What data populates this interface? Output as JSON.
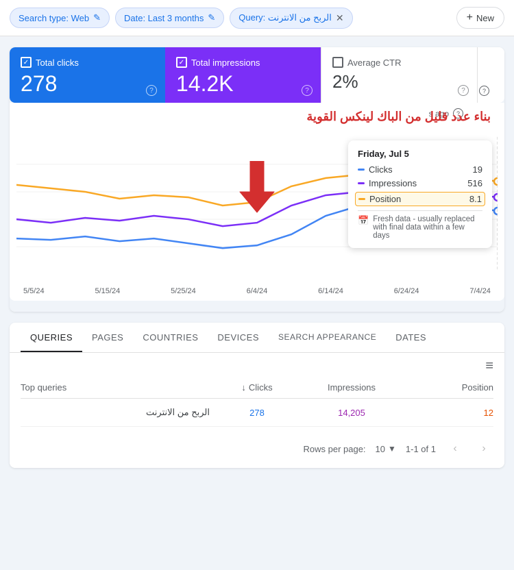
{
  "filterBar": {
    "chips": [
      {
        "id": "search-type",
        "label": "Search type: Web",
        "hasClose": false,
        "hasEdit": true
      },
      {
        "id": "date",
        "label": "Date: Last 3 months",
        "hasClose": false,
        "hasEdit": true
      },
      {
        "id": "query",
        "label": "Query: الربح من الانترنت",
        "hasClose": true,
        "hasEdit": false
      }
    ],
    "newButton": "New",
    "plusIcon": "+"
  },
  "metrics": {
    "totalClicks": {
      "label": "Total clicks",
      "value": "278",
      "checked": true,
      "color": "blue"
    },
    "totalImpressions": {
      "label": "Total impressions",
      "value": "14.2K",
      "checked": true,
      "color": "purple"
    },
    "averageCtr": {
      "label": "Average CTR",
      "value": "2%",
      "checked": false,
      "color": "white"
    }
  },
  "chart": {
    "annotation": "بناء عدد قليل من الباك لينكس القوية",
    "xLabels": [
      "5/5/24",
      "5/15/24",
      "5/25/24",
      "6/4/24",
      "6/14/24",
      "6/24/24",
      "7/4/24"
    ],
    "tooltip": {
      "date": "Friday, Jul 5",
      "agoText": "s ago",
      "rows": [
        {
          "label": "Clicks",
          "value": "19",
          "color": "#4285f4",
          "highlighted": false
        },
        {
          "label": "Impressions",
          "value": "516",
          "color": "#7b2ff7",
          "highlighted": false
        },
        {
          "label": "Position",
          "value": "8.1",
          "color": "#f9a825",
          "highlighted": true
        }
      ],
      "note": "Fresh data - usually replaced with final data within a few days"
    }
  },
  "tabs": {
    "items": [
      {
        "id": "queries",
        "label": "QUERIES",
        "active": true
      },
      {
        "id": "pages",
        "label": "PAGES",
        "active": false
      },
      {
        "id": "countries",
        "label": "COUNTRIES",
        "active": false
      },
      {
        "id": "devices",
        "label": "DEVICES",
        "active": false
      },
      {
        "id": "search-appearance",
        "label": "SEARCH APPEARANCE",
        "active": false
      },
      {
        "id": "dates",
        "label": "DATES",
        "active": false
      }
    ]
  },
  "table": {
    "headers": {
      "query": "Top queries",
      "clicks": "Clicks",
      "impressions": "Impressions",
      "position": "Position"
    },
    "rows": [
      {
        "query": "الربح من الانترنت",
        "clicks": "278",
        "impressions": "14,205",
        "position": "12"
      }
    ]
  },
  "pagination": {
    "rowsLabel": "Rows per page:",
    "rowsValue": "10",
    "count": "1-1 of 1"
  }
}
